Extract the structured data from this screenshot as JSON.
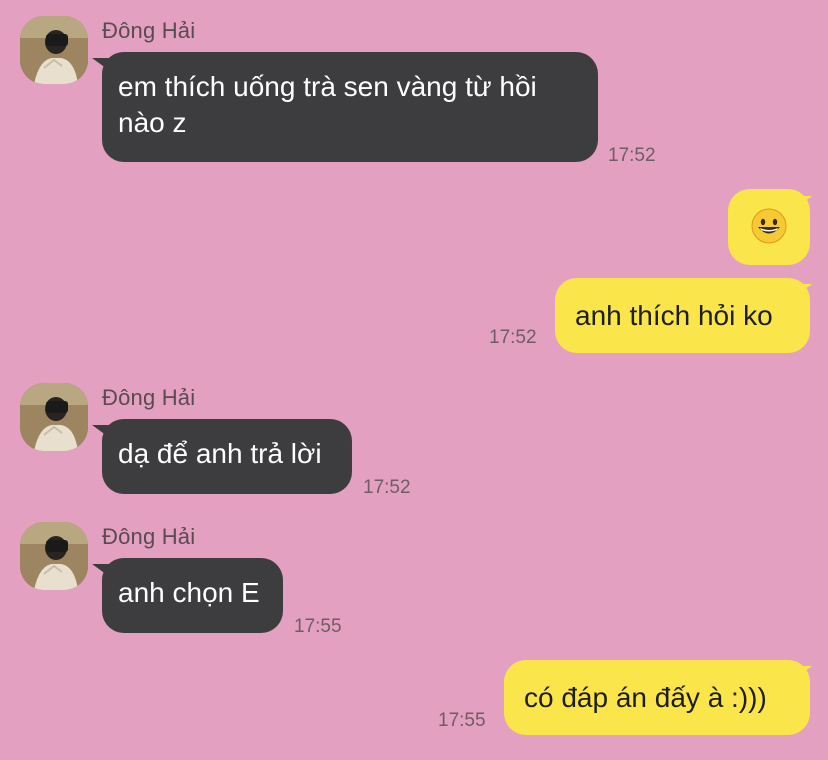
{
  "contact": {
    "name": "Đông Hải"
  },
  "messages": [
    {
      "sender": "Đông Hải",
      "text": "em thích uống trà sen vàng từ hồi nào z",
      "line1": "em thích uống trà sen vàng từ hồi",
      "line2": "nào z",
      "time": "17:52"
    },
    {
      "sender": "me",
      "emoji": "grinning-face",
      "time": ""
    },
    {
      "sender": "me",
      "text": "anh thích hỏi ko",
      "time": "17:52"
    },
    {
      "sender": "Đông Hải",
      "text": "dạ để anh trả lời",
      "time": "17:52"
    },
    {
      "sender": "Đông Hải",
      "text": "anh chọn E",
      "time": "17:55"
    },
    {
      "sender": "me",
      "text": "có đáp án đấy à :)))",
      "time": "17:55"
    }
  ],
  "colors": {
    "background": "#e4a0c1",
    "incoming_bubble": "#3d3d3f",
    "outgoing_bubble": "#fae54a"
  }
}
